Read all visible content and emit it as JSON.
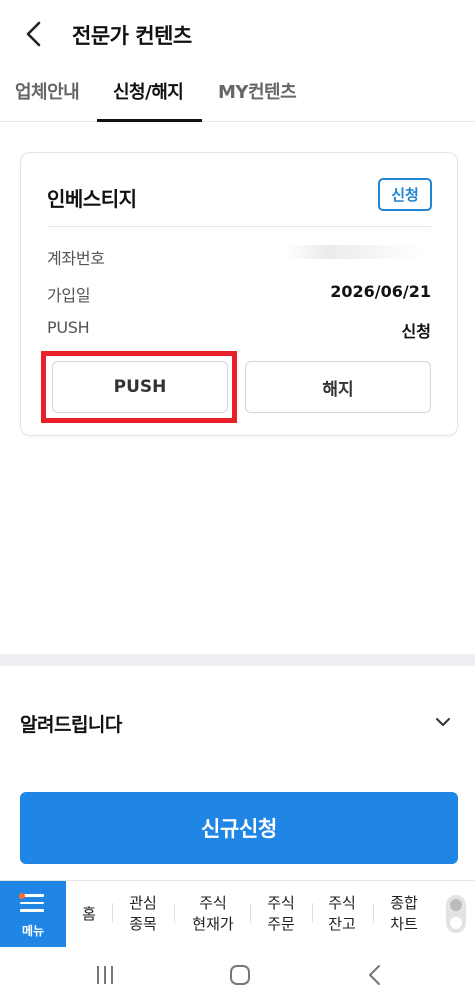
{
  "header": {
    "title": "전문가 컨텐츠",
    "back_icon": "chevron-left-icon"
  },
  "tabs": [
    {
      "label": "업체안내",
      "active": false
    },
    {
      "label": "신청/해지",
      "active": true
    },
    {
      "label": "MY컨텐츠",
      "active": false
    }
  ],
  "card": {
    "title": "인베스티지",
    "status": "신청",
    "rows": [
      {
        "label": "계좌번호",
        "value": ""
      },
      {
        "label": "가입일",
        "value": "2026/06/21"
      },
      {
        "label": "PUSH",
        "value": "신청"
      }
    ],
    "push_button": "PUSH",
    "cancel_button": "해지"
  },
  "notice": {
    "label": "알려드립니다",
    "icon": "chevron-down-icon"
  },
  "cta": {
    "label": "신규신청"
  },
  "bottom_nav": {
    "menu_label": "메뉴",
    "items": [
      {
        "line1": "홈",
        "line2": ""
      },
      {
        "line1": "관심",
        "line2": "종목"
      },
      {
        "line1": "주식",
        "line2": "현재가"
      },
      {
        "line1": "주식",
        "line2": "주문"
      },
      {
        "line1": "주식",
        "line2": "잔고"
      },
      {
        "line1": "종합",
        "line2": "차트"
      }
    ]
  },
  "colors": {
    "accent": "#1f86e6",
    "badge": "#1f86d4",
    "highlight": "#e8202a"
  }
}
